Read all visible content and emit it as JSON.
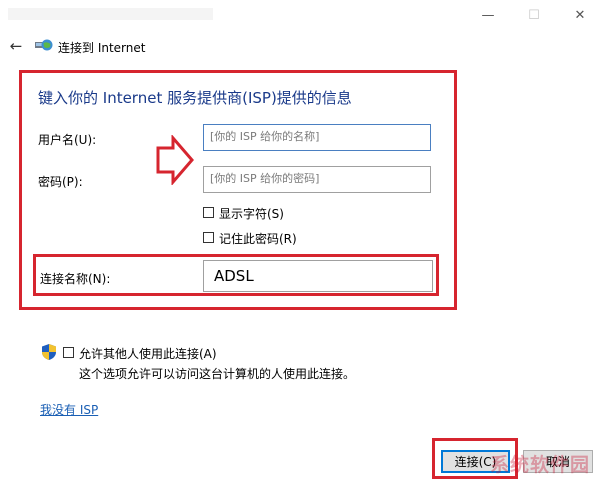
{
  "window": {
    "minimize_glyph": "—",
    "maximize_glyph": "☐",
    "close_glyph": "✕"
  },
  "nav": {
    "back_glyph": "←",
    "title": "连接到 Internet",
    "icon": "network-globe-icon"
  },
  "form": {
    "heading": "键入你的 Internet 服务提供商(ISP)提供的信息",
    "username_label": "用户名(U):",
    "username_placeholder": "[你的 ISP 给你的名称]",
    "password_label": "密码(P):",
    "password_placeholder": "[你的 ISP 给你的密码]",
    "show_chars_label": "显示字符(S)",
    "remember_password_label": "记住此密码(R)",
    "connection_name_label": "连接名称(N):",
    "connection_name_value": "ADSL"
  },
  "sharing": {
    "allow_others_label": "允许其他人使用此连接(A)",
    "allow_others_desc": "这个选项允许可以访问这台计算机的人使用此连接。",
    "shield_icon": "uac-shield-icon"
  },
  "no_isp_link": "我没有 ISP",
  "buttons": {
    "connect": "连接(C)",
    "cancel": "取消"
  },
  "watermark": "系统软件园",
  "colors": {
    "highlight_red": "#d6252f",
    "heading_blue": "#1a3a8a",
    "link_blue": "#1a5fb4",
    "focus_blue": "#0078d7"
  }
}
